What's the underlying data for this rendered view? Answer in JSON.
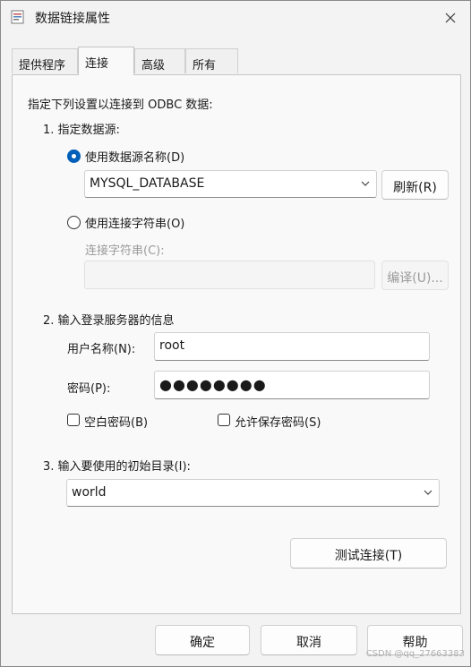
{
  "window": {
    "title": "数据链接属性"
  },
  "tabs": [
    {
      "label": "提供程序"
    },
    {
      "label": "连接"
    },
    {
      "label": "高级"
    },
    {
      "label": "所有"
    }
  ],
  "connection": {
    "intro": "指定下列设置以连接到 ODBC 数据:",
    "section1": {
      "title": "1. 指定数据源:",
      "use_dsn_label": "使用数据源名称(D)",
      "dsn_value": "MYSQL_DATABASE",
      "refresh_label": "刷新(R)",
      "use_connstr_label": "使用连接字符串(O)",
      "connstr_label": "连接字符串(C):",
      "connstr_value": "",
      "build_label": "编译(U)..."
    },
    "section2": {
      "title": "2. 输入登录服务器的信息",
      "username_label": "用户名称(N):",
      "username_value": "root",
      "password_label": "密码(P):",
      "password_mask": "●●●●●●●●",
      "blank_password_label": "空白密码(B)",
      "allow_save_label": "允许保存密码(S)"
    },
    "section3": {
      "title": "3. 输入要使用的初始目录(I):",
      "catalog_value": "world"
    },
    "test_label": "测试连接(T)"
  },
  "footer": {
    "ok_label": "确定",
    "cancel_label": "取消",
    "help_label": "帮助"
  },
  "watermark": "CSDN @qq_27663383",
  "colors": {
    "accent": "#005fb8",
    "window_bg": "#f3f3f3",
    "panel_bg": "#f9f9f9"
  }
}
